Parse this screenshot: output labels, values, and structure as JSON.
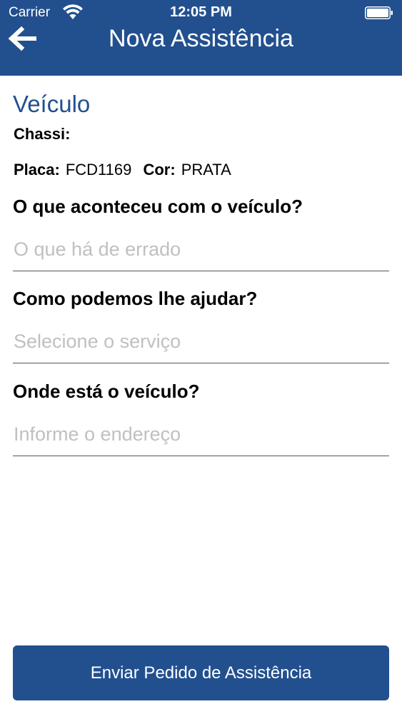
{
  "status_bar": {
    "carrier": "Carrier",
    "time": "12:05 PM"
  },
  "nav": {
    "title": "Nova Assistência",
    "back_icon": "arrow-left-icon"
  },
  "vehicle": {
    "section_title": "Veículo",
    "chassi_label": "Chassi:",
    "chassi_value": "",
    "placa_label": "Placa:",
    "placa_value": "FCD1169",
    "cor_label": "Cor:",
    "cor_value": "PRATA"
  },
  "form": {
    "problem": {
      "label": "O que aconteceu com o veículo?",
      "value": "",
      "placeholder": "O que há de errado"
    },
    "service": {
      "label": "Como podemos lhe ajudar?",
      "value": "",
      "placeholder": "Selecione o serviço"
    },
    "location": {
      "label": "Onde está o veículo?",
      "value": "",
      "placeholder": "Informe o endereço"
    }
  },
  "submit": {
    "label": "Enviar Pedido de Assistência"
  },
  "colors": {
    "primary": "#22508f",
    "placeholder": "#c0c0c4"
  }
}
